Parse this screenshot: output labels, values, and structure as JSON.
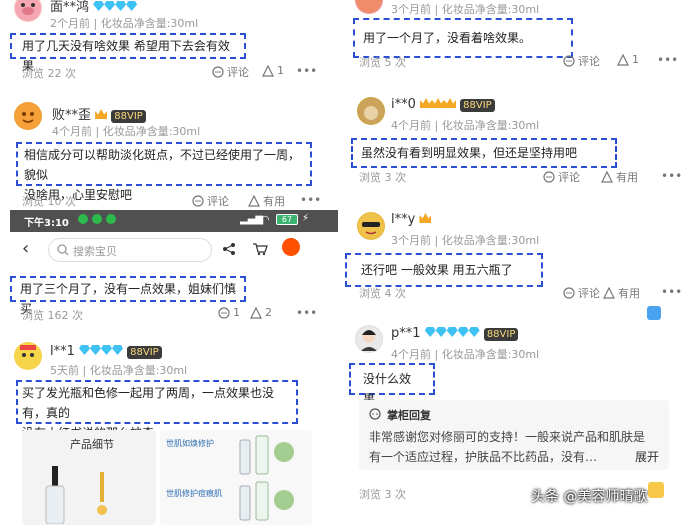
{
  "left": {
    "c1": {
      "name": "面**鸿",
      "meta": "2个月前 | 化妆品净含量:30ml",
      "review": "用了几天没有啥效果  希望用下去会有效果",
      "views": "浏览 22 次",
      "comment_label": "评论",
      "like_count": "1"
    },
    "c2": {
      "name": "败**歪",
      "vip": "88VIP",
      "meta": "4个月前 | 化妆品净含量:30ml",
      "review_line1": "相信成分可以帮助淡化斑点，不过已经使用了一周，貌似",
      "review_line2": "没啥用，心里安慰吧",
      "views": "浏览 10 次",
      "comment_label": "评论",
      "useful_label": "有用"
    },
    "phone": {
      "time": "下午3:10",
      "battery": "67",
      "search_placeholder": "搜索宝贝"
    },
    "c3": {
      "review": "用了三个月了，没有一点效果，姐妹们慎买",
      "views": "浏览 162 次",
      "comment_count": "1",
      "like_count": "2"
    },
    "c4": {
      "name": "l**1",
      "vip": "88VIP",
      "meta": "5天前 | 化妆品净含量:30ml",
      "review_line1": "买了发光瓶和色修一起用了两周，一点效果也没有，真的",
      "review_line2": "没有小红书说的那么神奇",
      "product_caption": "产品细节",
      "product_label_1": "世肌如焕修护",
      "product_label_2": "世肌修护痘痕肌"
    }
  },
  "right": {
    "c1": {
      "meta": "3个月前 | 化妆品净含量:30ml",
      "review": "用了一个月了，没看着啥效果。",
      "views": "浏览 5 次",
      "comment_label": "评论",
      "like_count": "1"
    },
    "c2": {
      "name": "i**0",
      "vip": "88VIP",
      "meta": "4个月前 | 化妆品净含量:30ml",
      "review": "虽然没有看到明显效果，但还是坚持用吧",
      "views": "浏览 3 次",
      "comment_label": "评论",
      "useful_label": "有用"
    },
    "c3": {
      "name": "l**y",
      "meta": "3个月前 | 化妆品净含量:30ml",
      "review": "还行吧 一般效果 用五六瓶了",
      "views": "浏览 4 次",
      "comment_label": "评论",
      "useful_label": "有用"
    },
    "c4": {
      "name": "p**1",
      "vip": "88VIP",
      "meta": "4个月前 | 化妆品净含量:30ml",
      "review": "没什么效果",
      "reply_title": "掌柜回复",
      "reply_line1": "非常感谢您对修丽可的支持！一般来说产品和肌肤是",
      "reply_line2": "有一个适应过程，护肤品不比药品，没有…",
      "expand_label": "展开",
      "views": "浏览 3 次",
      "watermark": "头条 @美容师晴歌"
    }
  }
}
